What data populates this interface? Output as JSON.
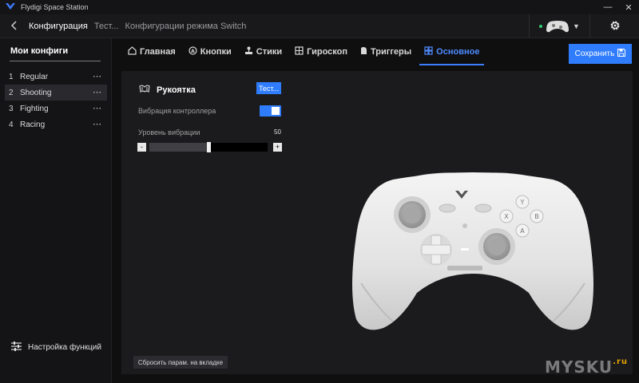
{
  "app": {
    "title": "Flydigi Space Station"
  },
  "window_controls": {
    "minimize": "—",
    "close": "✕"
  },
  "header": {
    "breadcrumbs": [
      "Конфигурация",
      "Тест...",
      "Конфигурации режима Switch"
    ],
    "device_status_color": "#2ecc71"
  },
  "sidebar": {
    "title": "Мои конфиги",
    "items": [
      {
        "num": "1",
        "label": "Regular",
        "more": "⋯"
      },
      {
        "num": "2",
        "label": "Shooting",
        "more": "⋯"
      },
      {
        "num": "3",
        "label": "Fighting",
        "more": "⋯"
      },
      {
        "num": "4",
        "label": "Racing",
        "more": "⋯"
      }
    ],
    "footer_label": "Настройка функций"
  },
  "tabs": [
    {
      "label": "Главная",
      "icon": "home-icon"
    },
    {
      "label": "Кнопки",
      "icon": "button-a-icon"
    },
    {
      "label": "Стики",
      "icon": "joystick-icon"
    },
    {
      "label": "Гироскоп",
      "icon": "gyro-icon"
    },
    {
      "label": "Триггеры",
      "icon": "trigger-icon"
    },
    {
      "label": "Основное",
      "icon": "grid-icon",
      "active": true
    }
  ],
  "toolbar": {
    "save_label": "Сохранить"
  },
  "grip": {
    "title": "Рукоятка",
    "test_label": "Тест...",
    "vibration_label": "Вибрация контроллера",
    "vibration_enabled": true,
    "level_label": "Уровень вибрации",
    "level_value": "50",
    "level_fraction": 0.5,
    "minus": "-",
    "plus": "+"
  },
  "reset_label": "Сбросить парам. на вкладке",
  "watermark": {
    "text": "MYSKU",
    "suffix": ".ru"
  },
  "colors": {
    "accent": "#2f7dfc",
    "background": "#0f0f10",
    "panel": "#1b1b1d"
  }
}
